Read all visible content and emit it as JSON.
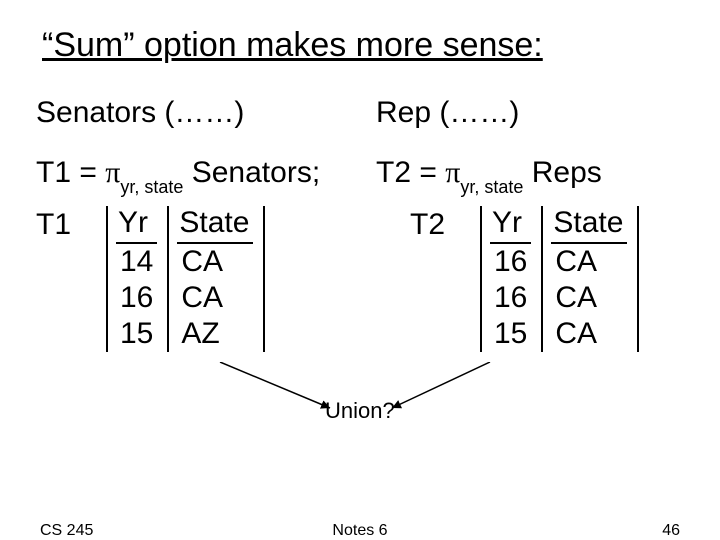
{
  "title": "“Sum” option makes more sense:",
  "schema": {
    "left": "Senators (……)",
    "right": "Rep (……)"
  },
  "defs": {
    "t1_label": "T1",
    "t2_label": "T2",
    "eq": " = ",
    "pi": "π",
    "sub": "yr, state",
    "rel1": " Senators;",
    "rel2": " Reps"
  },
  "tables": {
    "t1": {
      "label": "T1",
      "headers": {
        "c1": "Yr",
        "c2": "State"
      },
      "rows": [
        {
          "c1": "14",
          "c2": "CA"
        },
        {
          "c1": "16",
          "c2": "CA"
        },
        {
          "c1": "15",
          "c2": "AZ"
        }
      ]
    },
    "t2": {
      "label": "T2",
      "headers": {
        "c1": "Yr",
        "c2": "State"
      },
      "rows": [
        {
          "c1": "16",
          "c2": "CA"
        },
        {
          "c1": "16",
          "c2": "CA"
        },
        {
          "c1": "15",
          "c2": "CA"
        }
      ]
    }
  },
  "union_label": "Union?",
  "footer": {
    "left": "CS 245",
    "center": "Notes 6",
    "right": "46"
  }
}
